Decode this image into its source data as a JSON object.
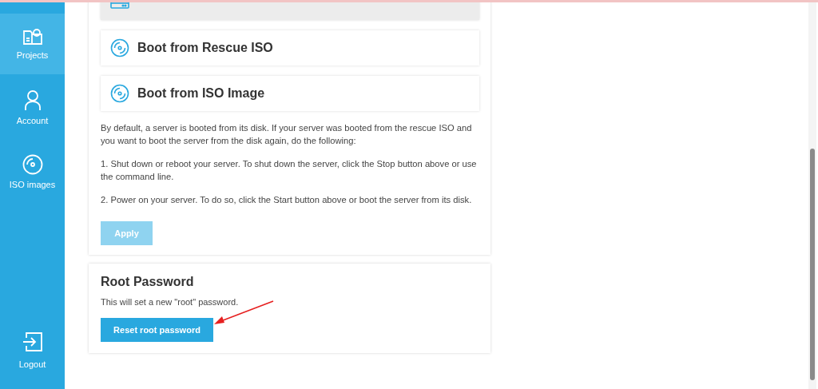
{
  "sidebar": {
    "items": [
      {
        "label": "Projects",
        "kind": "projects",
        "selected": true
      },
      {
        "label": "Account",
        "kind": "account",
        "selected": false
      },
      {
        "label": "ISO images",
        "kind": "iso",
        "selected": false
      }
    ],
    "logout": {
      "label": "Logout"
    }
  },
  "boot_options": [
    {
      "kind": "disk",
      "selected": true
    },
    {
      "label": "Boot from Rescue ISO",
      "kind": "iso",
      "selected": false
    },
    {
      "label": "Boot from ISO Image",
      "kind": "iso",
      "selected": false
    }
  ],
  "boot_description": [
    "By default, a server is booted from its disk. If your server was booted from the rescue ISO and you want to boot the server from the disk again, do the following:",
    "1. Shut down or reboot your server. To shut down the server, click the Stop button above or use the command line.",
    "2. Power on your server. To do so, click the Start button above or boot the server from its disk."
  ],
  "apply_button": {
    "label": "Apply",
    "disabled": true
  },
  "root_password": {
    "title": "Root Password",
    "description": "This will set a new \"root\" password.",
    "button": "Reset root password"
  }
}
